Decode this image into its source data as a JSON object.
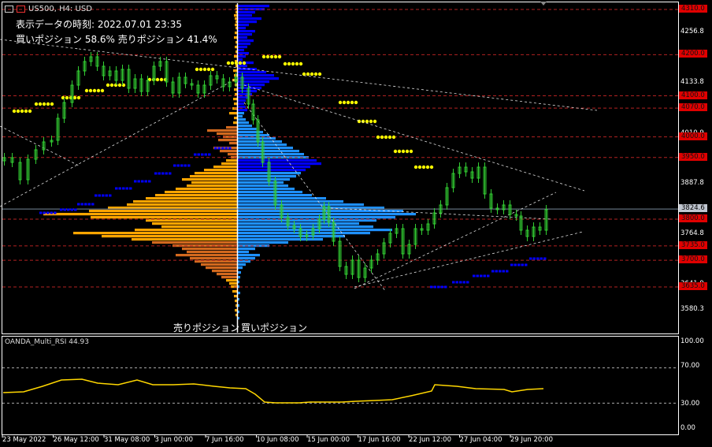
{
  "header": {
    "symbol": "US500, H4: USD"
  },
  "info": {
    "time_text": "表示データの時刻: 2022.07.01 23:35",
    "position_text": "買いポジション 58.6% 売りポジション 41.4%"
  },
  "volume_labels": {
    "sell": "売りポジション",
    "buy": "買いポジション"
  },
  "price_axis": {
    "labels": [
      "4256.8",
      "4133.8",
      "4010.9",
      "3887.8",
      "3764.8",
      "3641.9",
      "3580.3"
    ],
    "red_levels": [
      "4310.0",
      "4200.0",
      "4100.0",
      "4070.0",
      "4000.0",
      "3950.0",
      "3800.0",
      "3735.0",
      "3700.0",
      "3635.0"
    ],
    "current_price": "3824.6"
  },
  "rsi": {
    "title": "OANDA_Multi_RSI 44.93",
    "axis_labels": [
      "100.00",
      "70.00",
      "30.00",
      "0.00"
    ],
    "value": 44.93
  },
  "time_axis": [
    "23 May 2022",
    "26 May 12:00",
    "31 May 08:00",
    "3 Jun 00:00",
    "7 Jun 16:00",
    "10 Jun 08:00",
    "15 Jun 00:00",
    "17 Jun 16:00",
    "22 Jun 12:00",
    "27 Jun 04:00",
    "29 Jun 20:00"
  ],
  "colors": {
    "candle": "#32cd32",
    "sell_bar": "#ffa500",
    "sell_bar_dark": "#d2691e",
    "buy_bar": "#1e90ff",
    "buy_bar_dark": "#0000ff",
    "level_line": "#b22222",
    "level_label_bg": "#e00000",
    "rsi_line": "#ffd700",
    "dot_yellow": "#ffff00",
    "dot_blue": "#0000ff"
  }
}
